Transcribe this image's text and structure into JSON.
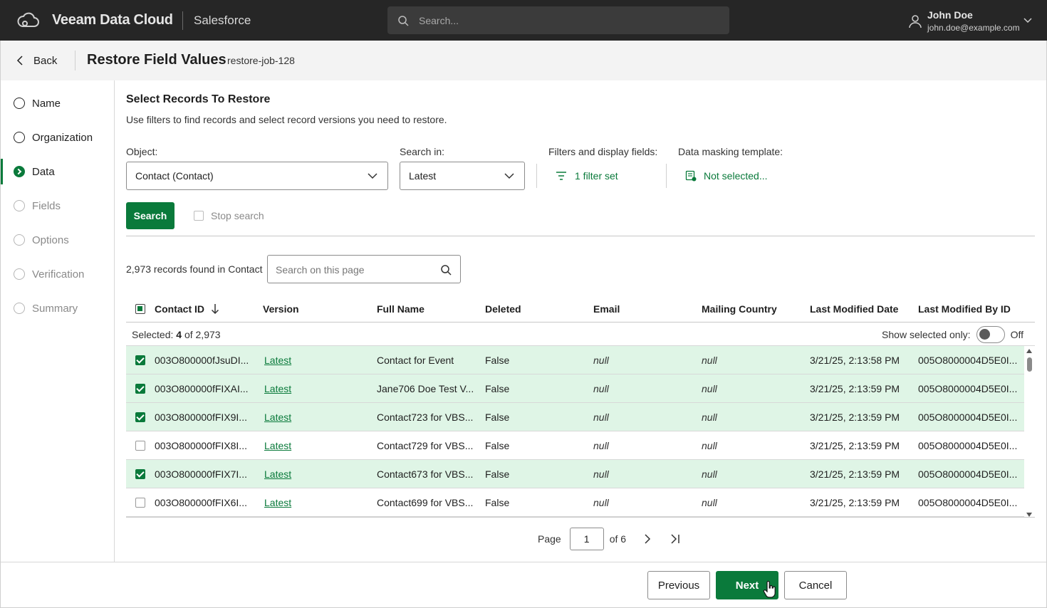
{
  "app": {
    "brand": "Veeam Data Cloud",
    "product": "Salesforce",
    "search_placeholder": "Search...",
    "user_name": "John Doe",
    "user_email": "john.doe@example.com"
  },
  "header": {
    "back_label": "Back",
    "title": "Restore Field Values",
    "job_name": "restore-job-128"
  },
  "steps": [
    {
      "label": "Name",
      "state": "done"
    },
    {
      "label": "Organization",
      "state": "done"
    },
    {
      "label": "Data",
      "state": "active"
    },
    {
      "label": "Fields",
      "state": "pending"
    },
    {
      "label": "Options",
      "state": "pending"
    },
    {
      "label": "Verification",
      "state": "pending"
    },
    {
      "label": "Summary",
      "state": "pending"
    }
  ],
  "section": {
    "title": "Select Records To Restore",
    "description": "Use filters to find records and select record versions you need to restore."
  },
  "filters": {
    "object_label": "Object:",
    "object_value": "Contact (Contact)",
    "search_in_label": "Search in:",
    "search_in_value": "Latest",
    "filters_label": "Filters and display fields:",
    "filters_value": "1 filter set",
    "masking_label": "Data masking template:",
    "masking_value": "Not selected...",
    "search_button": "Search",
    "stop_search_label": "Stop search"
  },
  "results": {
    "found_text": "2,973 records found in Contact",
    "page_search_placeholder": "Search on this page",
    "selected_label": "Selected:",
    "selected_count": "4",
    "selected_total": "of 2,973",
    "show_selected_label": "Show selected only:",
    "show_selected_state": "Off"
  },
  "table": {
    "columns": [
      "Contact ID",
      "Version",
      "Full Name",
      "Deleted",
      "Email",
      "Mailing Country",
      "Last Modified Date",
      "Last Modified By ID"
    ],
    "rows": [
      {
        "selected": true,
        "contact_id": "003O800000fJsuDI...",
        "version": "Latest",
        "full_name": "Contact for Event",
        "deleted": "False",
        "email": "null",
        "country": "null",
        "modified": "3/21/25, 2:13:58 PM",
        "modified_by": "005O8000004D5E0I..."
      },
      {
        "selected": true,
        "contact_id": "003O800000fFIXAI...",
        "version": "Latest",
        "full_name": "Jane706 Doe Test V...",
        "deleted": "False",
        "email": "null",
        "country": "null",
        "modified": "3/21/25, 2:13:59 PM",
        "modified_by": "005O8000004D5E0I..."
      },
      {
        "selected": true,
        "contact_id": "003O800000fFIX9I...",
        "version": "Latest",
        "full_name": "Contact723 for VBS...",
        "deleted": "False",
        "email": "null",
        "country": "null",
        "modified": "3/21/25, 2:13:59 PM",
        "modified_by": "005O8000004D5E0I..."
      },
      {
        "selected": false,
        "contact_id": "003O800000fFIX8I...",
        "version": "Latest",
        "full_name": "Contact729 for VBS...",
        "deleted": "False",
        "email": "null",
        "country": "null",
        "modified": "3/21/25, 2:13:59 PM",
        "modified_by": "005O8000004D5E0I..."
      },
      {
        "selected": true,
        "contact_id": "003O800000fFIX7I...",
        "version": "Latest",
        "full_name": "Contact673 for VBS...",
        "deleted": "False",
        "email": "null",
        "country": "null",
        "modified": "3/21/25, 2:13:59 PM",
        "modified_by": "005O8000004D5E0I..."
      },
      {
        "selected": false,
        "contact_id": "003O800000fFIX6I...",
        "version": "Latest",
        "full_name": "Contact699 for VBS...",
        "deleted": "False",
        "email": "null",
        "country": "null",
        "modified": "3/21/25, 2:13:59 PM",
        "modified_by": "005O8000004D5E0I..."
      }
    ]
  },
  "pager": {
    "page_label": "Page",
    "current": "1",
    "of_text": "of 6"
  },
  "footer": {
    "previous": "Previous",
    "next": "Next",
    "cancel": "Cancel"
  },
  "colors": {
    "accent": "#0a7a3b",
    "selected_row": "#dff5e6",
    "topbar": "#262626"
  }
}
